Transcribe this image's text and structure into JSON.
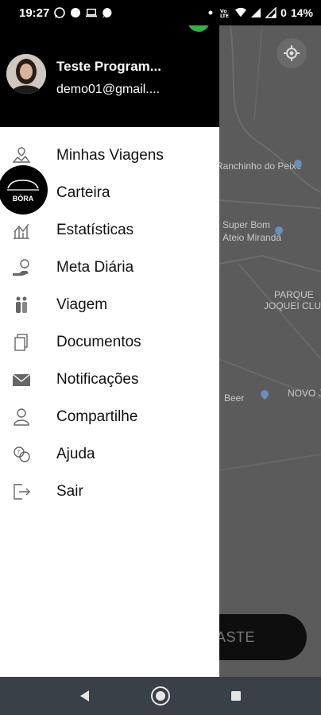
{
  "status_bar": {
    "time": "19:27",
    "battery": "14%",
    "battery_level": "0"
  },
  "drawer": {
    "user_name": "Teste Program...",
    "user_email": "demo01@gmail...."
  },
  "menu": [
    {
      "label": "Minhas Viagens",
      "icon": "trips-map-icon"
    },
    {
      "label": "Carteira",
      "icon": "wallet-icon"
    },
    {
      "label": "Estatísticas",
      "icon": "chart-icon"
    },
    {
      "label": "Meta Diária",
      "icon": "goal-money-icon"
    },
    {
      "label": "Viagem",
      "icon": "travelers-icon"
    },
    {
      "label": "Documentos",
      "icon": "documents-icon"
    },
    {
      "label": "Notificações",
      "icon": "envelope-icon"
    },
    {
      "label": "Compartilhe",
      "icon": "person-icon"
    },
    {
      "label": "Ajuda",
      "icon": "help-icon"
    },
    {
      "label": "Sair",
      "icon": "logout-icon"
    }
  ],
  "logo": {
    "text": "BÓRA"
  },
  "map": {
    "labels": [
      "Ranchinho do Peixe",
      "Super Bom",
      "Ateio Miranda",
      "PARQUE",
      "JOQUEI CLUB",
      "Beer",
      "NOVO J"
    ]
  },
  "bottom_button_label": "ASTE",
  "colors": {
    "online": "#2fb347",
    "drawer_header": "#000000",
    "map": "#5b5b5b",
    "nav_bar": "#3a4048"
  }
}
